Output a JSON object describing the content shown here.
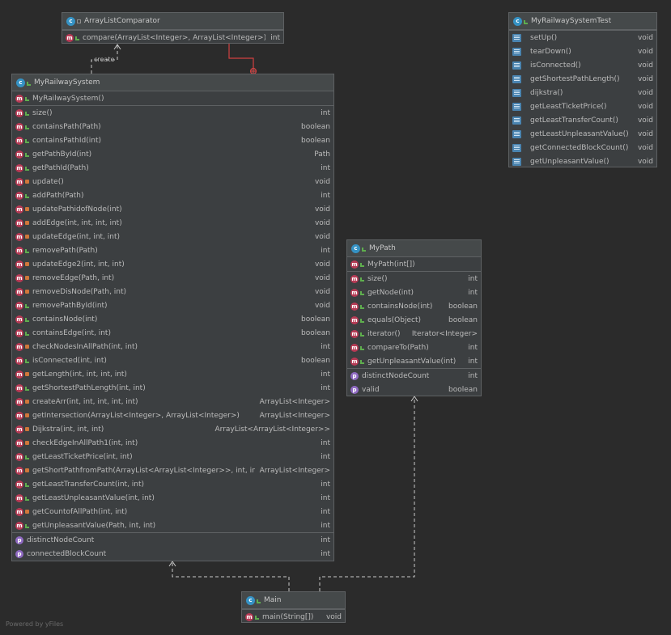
{
  "footer": "Powered by yFiles",
  "edge_label_create": "create",
  "colors": {
    "background": "#2b2b2b",
    "node_fill": "#3c3f41",
    "class_badge": "#3592c4",
    "method_badge": "#b73a55",
    "property_badge": "#8f6ac2",
    "public": "#5fae4e",
    "private": "#d0763a",
    "inner_edge": "#d04040"
  },
  "classes": {
    "comparator": {
      "name": "ArrayListComparator",
      "methods": [
        {
          "name": "compare(ArrayList<Integer>, ArrayList<Integer>)",
          "type": "int",
          "vis": "pub"
        }
      ]
    },
    "test": {
      "name": "MyRailwaySystemTest",
      "methods": [
        {
          "name": "setUp()",
          "type": "void"
        },
        {
          "name": "tearDown()",
          "type": "void"
        },
        {
          "name": "isConnected()",
          "type": "void"
        },
        {
          "name": "getShortestPathLength()",
          "type": "void"
        },
        {
          "name": "dijkstra()",
          "type": "void"
        },
        {
          "name": "getLeastTicketPrice()",
          "type": "void"
        },
        {
          "name": "getLeastTransferCount()",
          "type": "void"
        },
        {
          "name": "getLeastUnpleasantValue()",
          "type": "void"
        },
        {
          "name": "getConnectedBlockCount()",
          "type": "void"
        },
        {
          "name": "getUnpleasantValue()",
          "type": "void"
        }
      ]
    },
    "railway": {
      "name": "MyRailwaySystem",
      "constructor": "MyRailwaySystem()",
      "methods": [
        {
          "name": "size()",
          "type": "int",
          "vis": "pub"
        },
        {
          "name": "containsPath(Path)",
          "type": "boolean",
          "vis": "pub"
        },
        {
          "name": "containsPathId(int)",
          "type": "boolean",
          "vis": "pub"
        },
        {
          "name": "getPathById(int)",
          "type": "Path",
          "vis": "pub"
        },
        {
          "name": "getPathId(Path)",
          "type": "int",
          "vis": "pub"
        },
        {
          "name": "update()",
          "type": "void",
          "vis": "priv"
        },
        {
          "name": "addPath(Path)",
          "type": "int",
          "vis": "pub"
        },
        {
          "name": "updatePathidofNode(int)",
          "type": "void",
          "vis": "priv"
        },
        {
          "name": "addEdge(int, int, int, int)",
          "type": "void",
          "vis": "priv"
        },
        {
          "name": "updateEdge(int, int, int)",
          "type": "void",
          "vis": "priv"
        },
        {
          "name": "removePath(Path)",
          "type": "int",
          "vis": "pub"
        },
        {
          "name": "updateEdge2(int, int, int)",
          "type": "void",
          "vis": "priv"
        },
        {
          "name": "removeEdge(Path, int)",
          "type": "void",
          "vis": "priv"
        },
        {
          "name": "removeDisNode(Path, int)",
          "type": "void",
          "vis": "priv"
        },
        {
          "name": "removePathById(int)",
          "type": "void",
          "vis": "pub"
        },
        {
          "name": "containsNode(int)",
          "type": "boolean",
          "vis": "pub"
        },
        {
          "name": "containsEdge(int, int)",
          "type": "boolean",
          "vis": "pub"
        },
        {
          "name": "checkNodesInAllPath(int, int)",
          "type": "int",
          "vis": "priv"
        },
        {
          "name": "isConnected(int, int)",
          "type": "boolean",
          "vis": "pub"
        },
        {
          "name": "getLength(int, int, int, int)",
          "type": "int",
          "vis": "priv"
        },
        {
          "name": "getShortestPathLength(int, int)",
          "type": "int",
          "vis": "pub"
        },
        {
          "name": "createArr(int, int, int, int, int)",
          "type": "ArrayList<Integer>",
          "vis": "priv"
        },
        {
          "name": "getIntersection(ArrayList<Integer>, ArrayList<Integer>)",
          "type": "ArrayList<Integer>",
          "vis": "priv"
        },
        {
          "name": "Dijkstra(int, int, int)",
          "type": "ArrayList<ArrayList<Integer>>",
          "vis": "priv"
        },
        {
          "name": "checkEdgeInAllPath1(int, int)",
          "type": "int",
          "vis": "priv"
        },
        {
          "name": "getLeastTicketPrice(int, int)",
          "type": "int",
          "vis": "pub"
        },
        {
          "name": "getShortPathfromPath(ArrayList<ArrayList<Integer>>, int, int)",
          "type": "ArrayList<Integer>",
          "vis": "priv"
        },
        {
          "name": "getLeastTransferCount(int, int)",
          "type": "int",
          "vis": "pub"
        },
        {
          "name": "getLeastUnpleasantValue(int, int)",
          "type": "int",
          "vis": "pub"
        },
        {
          "name": "getCountofAllPath(int, int)",
          "type": "int",
          "vis": "priv"
        },
        {
          "name": "getUnpleasantValue(Path, int, int)",
          "type": "int",
          "vis": "pub"
        }
      ],
      "properties": [
        {
          "name": "distinctNodeCount",
          "type": "int"
        },
        {
          "name": "connectedBlockCount",
          "type": "int"
        }
      ]
    },
    "path": {
      "name": "MyPath",
      "constructor": "MyPath(int[])",
      "methods": [
        {
          "name": "size()",
          "type": "int",
          "vis": "pub"
        },
        {
          "name": "getNode(int)",
          "type": "int",
          "vis": "pub"
        },
        {
          "name": "containsNode(int)",
          "type": "boolean",
          "vis": "pub"
        },
        {
          "name": "equals(Object)",
          "type": "boolean",
          "vis": "pub"
        },
        {
          "name": "iterator()",
          "type": "Iterator<Integer>",
          "vis": "pub"
        },
        {
          "name": "compareTo(Path)",
          "type": "int",
          "vis": "pub"
        },
        {
          "name": "getUnpleasantValue(int)",
          "type": "int",
          "vis": "pub"
        }
      ],
      "properties": [
        {
          "name": "distinctNodeCount",
          "type": "int"
        },
        {
          "name": "valid",
          "type": "boolean"
        }
      ]
    },
    "main": {
      "name": "Main",
      "methods": [
        {
          "name": "main(String[])",
          "type": "void",
          "vis": "pub"
        }
      ]
    }
  }
}
